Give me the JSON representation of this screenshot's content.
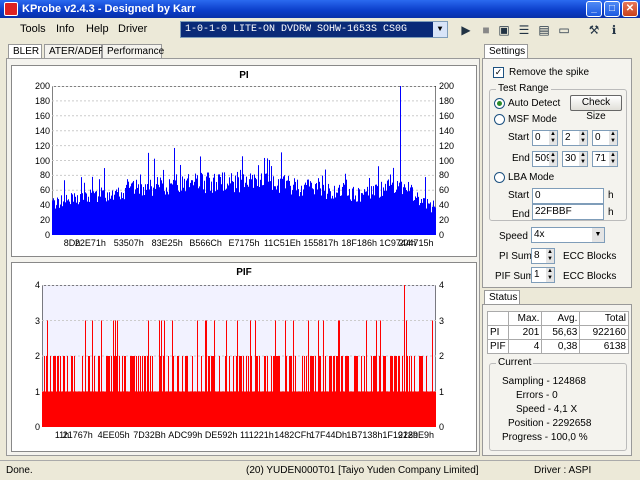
{
  "title": "KProbe v2.4.3 - Designed by Karr",
  "menu": [
    "Tools",
    "Info",
    "Help",
    "Driver"
  ],
  "drive": "1-0-1-0 LITE-ON DVDRW SOHW-1653S CS0G",
  "tabs": [
    "BLER",
    "ATER/ADER",
    "Performance"
  ],
  "settings_tab": "Settings",
  "status_tab": "Status",
  "chart_data": [
    {
      "type": "bar",
      "title": "PI",
      "ylim": [
        0,
        200
      ],
      "yticks": [
        "0",
        "20",
        "40",
        "60",
        "80",
        "100",
        "120",
        "140",
        "160",
        "180",
        "200"
      ],
      "xticks": [
        "8Dh",
        "22E71h",
        "53507h",
        "83E25h",
        "B566Ch",
        "E7175h",
        "11C51Eh",
        "155817h",
        "18F186h",
        "1C9744h",
        "204715h"
      ],
      "color": "#0000ff",
      "max": 201,
      "avg": 56.63
    },
    {
      "type": "bar",
      "title": "PIF",
      "ylim": [
        0,
        4
      ],
      "yticks": [
        "0",
        "1",
        "2",
        "3",
        "4"
      ],
      "xticks": [
        "11h",
        "21767h",
        "4EE05h",
        "7D32Bh",
        "ADC99h",
        "DE592h",
        "111221h",
        "1482CFh",
        "17F44Dh",
        "1B7138h",
        "1F1912h",
        "2289E9h"
      ],
      "color": "#ff0000",
      "max": 4,
      "avg": 0.38
    }
  ],
  "settings": {
    "remove_spike": "Remove the spike",
    "test_range": "Test Range",
    "auto_detect": "Auto Detect",
    "check_size": "Check Size",
    "msf_mode": "MSF Mode",
    "start": "Start",
    "end": "End",
    "msf_start": [
      "0",
      "2",
      "0"
    ],
    "msf_end": [
      "509",
      "30",
      "71"
    ],
    "lba_mode": "LBA Mode",
    "lba_start": "0",
    "lba_end": "22FBBF",
    "h": "h",
    "speed_label": "Speed",
    "speed": "4x",
    "pi_sum_label": "PI Sum",
    "pi_sum": "8",
    "pif_sum_label": "PIF Sum",
    "pif_sum": "1",
    "ecc": "ECC Blocks"
  },
  "status": {
    "headers": [
      "Max.",
      "Avg.",
      "Total"
    ],
    "rows": [
      {
        "name": "PI",
        "max": "201",
        "avg": "56,63",
        "total": "922160"
      },
      {
        "name": "PIF",
        "max": "4",
        "avg": "0,38",
        "total": "6138"
      }
    ],
    "current": "Current",
    "sampling": "Sampling - 124868",
    "errors": "Errors - 0",
    "speed": "Speed - 4,1 X",
    "position": "Position - 2292658",
    "progress": "Progress - 100,0 %"
  },
  "statusbar": {
    "left": "Done.",
    "center": "(20) YUDEN000T01 [Taiyo Yuden Company Limited]",
    "right": "Driver : ASPI"
  }
}
